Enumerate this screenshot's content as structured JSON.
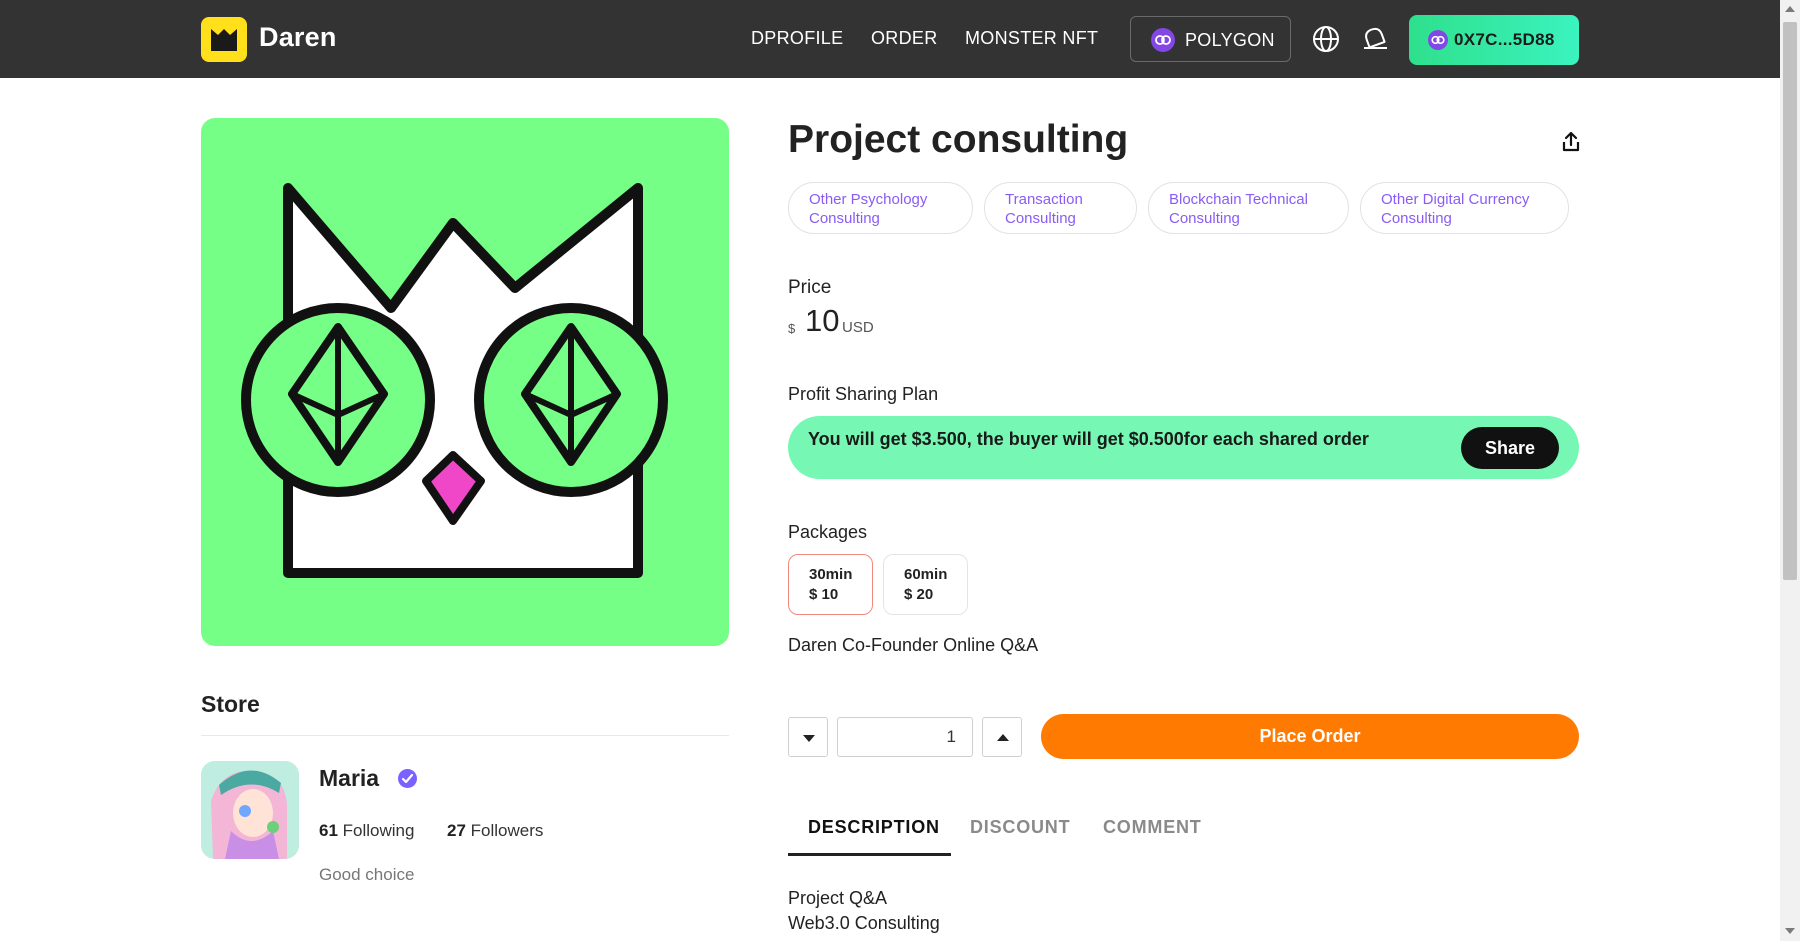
{
  "header": {
    "brand": "Daren",
    "nav": [
      "DPROFILE",
      "ORDER",
      "MONSTER NFT"
    ],
    "chain_label": "POLYGON",
    "wallet_label": "0X7C...5D88"
  },
  "product": {
    "title": "Project consulting",
    "tags": [
      {
        "line1": "Other Psychology",
        "line2": "Consulting"
      },
      {
        "line1": "Transaction",
        "line2": "Consulting"
      },
      {
        "line1": "Blockchain Technical",
        "line2": "Consulting"
      },
      {
        "line1": "Other Digital Currency",
        "line2": "Consulting"
      }
    ],
    "price_label": "Price",
    "price_currency_symbol": "$",
    "price_amount": "10",
    "price_unit": "USD",
    "profit_label": "Profit Sharing Plan",
    "profit_text": "You will get $3.500, the buyer will get $0.500for each shared order",
    "profit_share_button": "Share",
    "packages_label": "Packages",
    "packages": [
      {
        "duration": "30min",
        "price": "$ 10",
        "selected": true
      },
      {
        "duration": "60min",
        "price": "$ 20",
        "selected": false
      }
    ],
    "package_description": "Daren Co-Founder Online Q&A",
    "quantity": "1",
    "place_order_label": "Place Order"
  },
  "tabs": [
    {
      "label": "DESCRIPTION",
      "active": true
    },
    {
      "label": "DISCOUNT",
      "active": false
    },
    {
      "label": "COMMENT",
      "active": false
    }
  ],
  "description_lines": [
    "Project Q&A",
    "Web3.0 Consulting"
  ],
  "store": {
    "title": "Store",
    "user_name": "Maria",
    "following_count": "61",
    "following_label": "Following",
    "followers_count": "27",
    "followers_label": "Followers",
    "bio": "Good choice"
  },
  "icons": {
    "logo": "daren-crown-logo",
    "chain": "polygon-icon",
    "globe": "globe-icon",
    "notify": "bell-icon",
    "share": "share-upload-icon",
    "verified": "verified-check-icon"
  },
  "colors": {
    "header_bg": "#333333",
    "hero_bg": "#76ff87",
    "accent_purple": "#8a5cf5",
    "profit_bg": "#76f8b4",
    "order_orange": "#ff7a00",
    "wallet_green": "#2ee08c",
    "logo_yellow": "#ffe01b"
  }
}
